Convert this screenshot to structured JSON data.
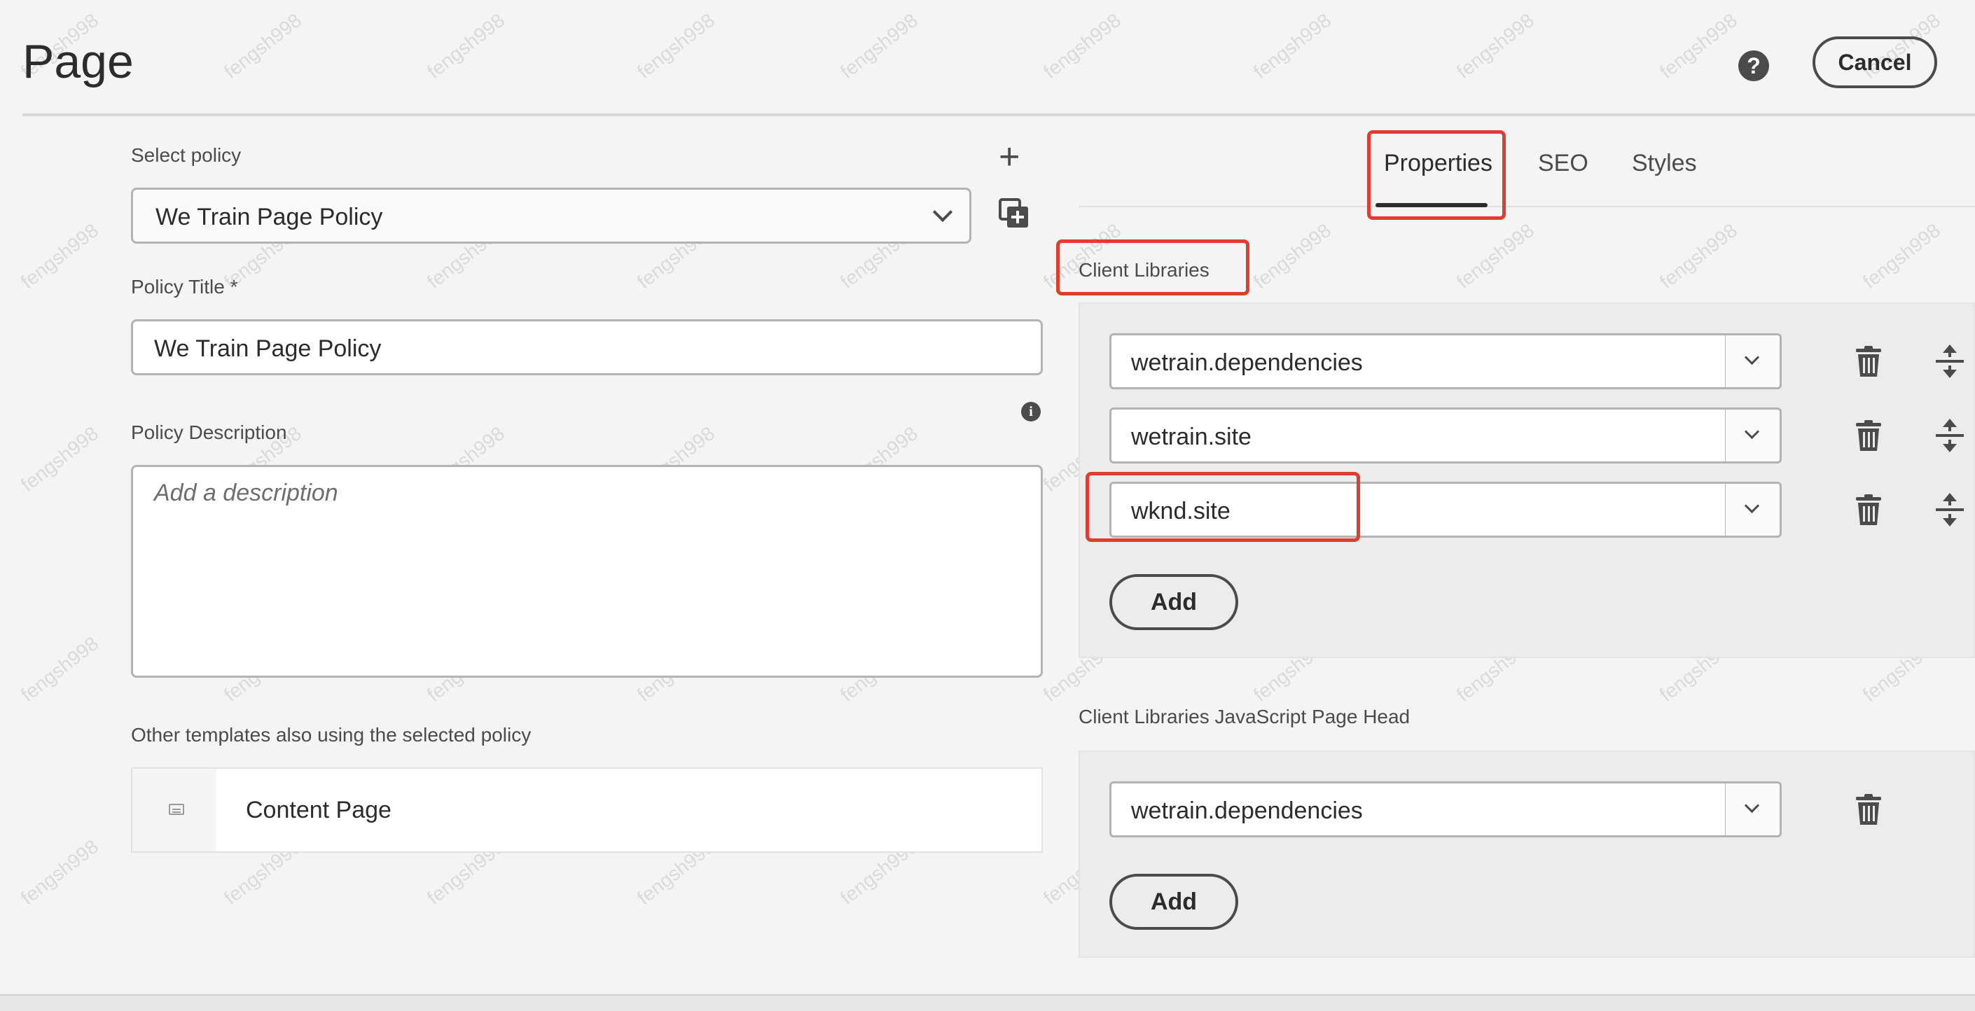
{
  "header": {
    "title": "Page",
    "cancel_label": "Cancel",
    "help_icon": "help-icon"
  },
  "left": {
    "select_policy_label": "Select policy",
    "selected_policy": "We Train Page Policy",
    "policy_title_label": "Policy Title *",
    "policy_title_value": "We Train Page Policy",
    "policy_description_label": "Policy Description",
    "policy_description_placeholder": "Add a description",
    "other_templates_label": "Other templates also using the selected policy",
    "templates": [
      "Content Page"
    ]
  },
  "tabs": [
    {
      "label": "Properties",
      "active": true
    },
    {
      "label": "SEO",
      "active": false
    },
    {
      "label": "Styles",
      "active": false
    }
  ],
  "client_libraries": {
    "label": "Client Libraries",
    "items": [
      "wetrain.dependencies",
      "wetrain.site",
      "wknd.site"
    ],
    "add_label": "Add"
  },
  "client_libraries_head": {
    "label": "Client Libraries JavaScript Page Head",
    "items": [
      "wetrain.dependencies"
    ],
    "add_label": "Add"
  },
  "watermark": "fengsh998",
  "colors": {
    "highlight": "#e03c31",
    "text": "#2c2c2c",
    "border": "#b3b3b3"
  }
}
